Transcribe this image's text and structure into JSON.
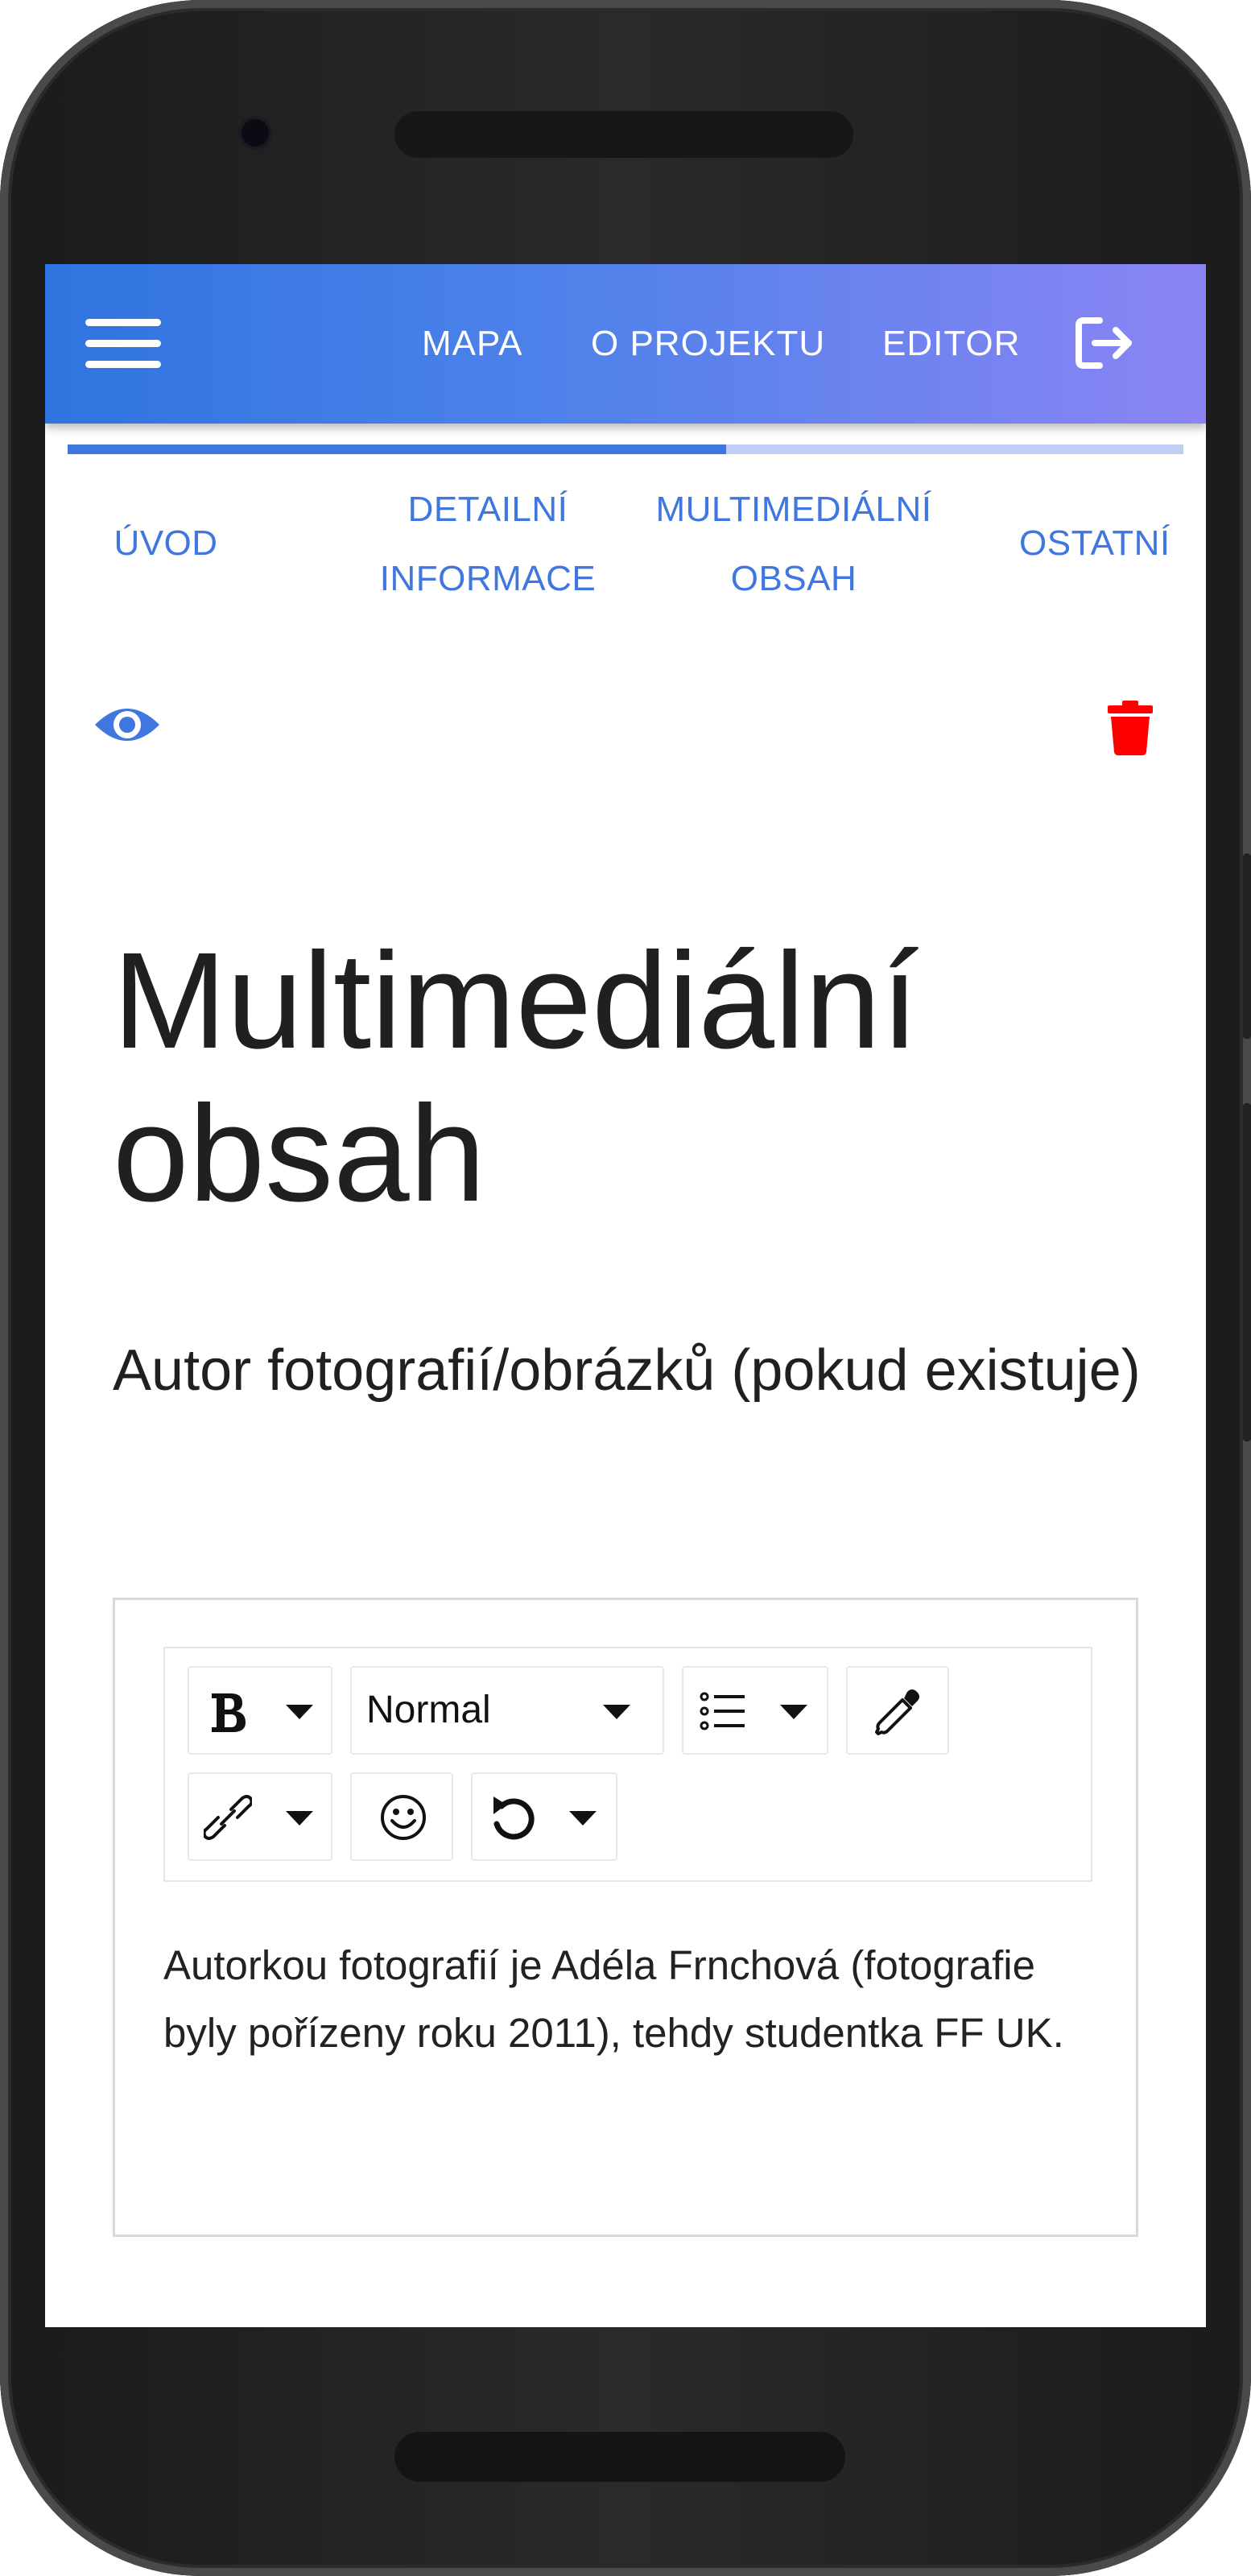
{
  "appbar": {
    "nav": {
      "mapa": "MAPA",
      "projekt": "O PROJEKTU",
      "editor": "EDITOR"
    }
  },
  "stepper": {
    "progress_percent": 59,
    "tabs": {
      "uvod": "ÚVOD",
      "detail_line1": "DETAILNÍ",
      "detail_line2": "INFORMACE",
      "multi_line1": "MULTIMEDIÁLNÍ",
      "multi_line2": "OBSAH",
      "ostatni": "OSTATNÍ"
    }
  },
  "main": {
    "title": "Multimediální obsah",
    "field_label": "Autor fotografií/obrázků (pokud existuje)",
    "editor": {
      "block_type": "Normal",
      "content": "Autorkou fotografií je Adéla Frnchová (fotografie byly pořízeny roku 2011), tehdy studentka FF UK."
    }
  },
  "colors": {
    "accent": "#3f76e0",
    "delete": "#ff0000",
    "appbar_start": "#2f74e0",
    "appbar_end": "#8b84f4"
  },
  "icons": {
    "menu": "hamburger-menu-icon",
    "logout": "logout-icon",
    "preview": "eye-icon",
    "delete": "trash-icon",
    "bold": "bold-icon",
    "list": "list-icon",
    "color": "eyedropper-icon",
    "link": "link-icon",
    "emoji": "smiley-icon",
    "history": "undo-icon"
  }
}
